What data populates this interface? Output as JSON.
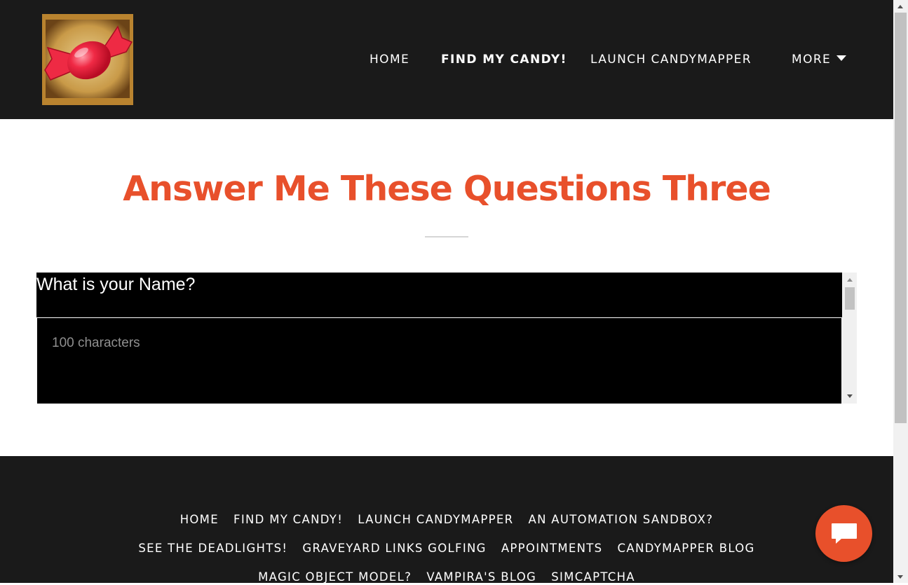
{
  "header": {
    "logo_icon": "candy-icon",
    "nav": {
      "home": "HOME",
      "find": "FIND MY CANDY!",
      "launch": "LAUNCH CANDYMAPPER",
      "more": "MORE"
    }
  },
  "main": {
    "title": "Answer Me These Questions Three",
    "form": {
      "question": "What is your Name?",
      "answer_placeholder": "100 characters"
    }
  },
  "footer": {
    "row1": [
      "HOME",
      "FIND MY CANDY!",
      "LAUNCH CANDYMAPPER",
      "AN AUTOMATION SANDBOX?"
    ],
    "row2": [
      "SEE THE DEADLIGHTS!",
      "GRAVEYARD LINKS GOLFING",
      "APPOINTMENTS",
      "CANDYMAPPER BLOG"
    ],
    "row3": [
      "MAGIC OBJECT MODEL?",
      "VAMPIRA'S BLOG",
      "SIMCAPTCHA"
    ]
  },
  "chat": {
    "icon": "chat-bubble-icon"
  },
  "colors": {
    "accent": "#e8502b",
    "header_bg": "#1a1a1a",
    "form_bg": "#000000"
  }
}
